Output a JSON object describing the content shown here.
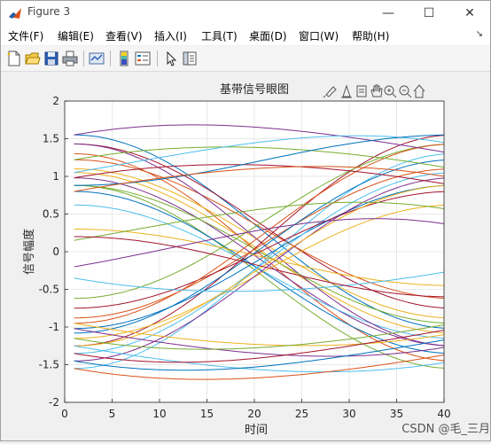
{
  "window": {
    "title": "Figure 3",
    "minimize": "—",
    "maximize": "☐",
    "close": "✕"
  },
  "menu": [
    {
      "label": "文件(F)"
    },
    {
      "label": "编辑(E)"
    },
    {
      "label": "查看(V)"
    },
    {
      "label": "插入(I)"
    },
    {
      "label": "工具(T)"
    },
    {
      "label": "桌面(D)"
    },
    {
      "label": "窗口(W)"
    },
    {
      "label": "帮助(H)"
    }
  ],
  "toolbar": [
    {
      "icon": "new-figure-icon"
    },
    {
      "icon": "open-file-icon"
    },
    {
      "icon": "save-icon"
    },
    {
      "icon": "print-icon"
    },
    {
      "icon": "link-figure-icon"
    },
    {
      "icon": "insert-colorbar-icon"
    },
    {
      "icon": "insert-legend-icon"
    },
    {
      "icon": "edit-plot-icon"
    },
    {
      "icon": "property-inspector-icon"
    }
  ],
  "axes_toolbar": [
    {
      "icon": "brush-icon"
    },
    {
      "icon": "data-tips-icon"
    },
    {
      "icon": "export-icon"
    },
    {
      "icon": "pan-icon"
    },
    {
      "icon": "zoom-in-icon"
    },
    {
      "icon": "zoom-out-icon"
    },
    {
      "icon": "home-icon"
    }
  ],
  "watermark": "CSDN @毛_三月",
  "colors": [
    "#0072BD",
    "#D95319",
    "#EDB120",
    "#7E2F8E",
    "#77AC30",
    "#4DBEEE",
    "#A2142F"
  ],
  "chart_data": {
    "type": "line",
    "title": "基带信号眼图",
    "xlabel": "时间",
    "ylabel": "信号幅度",
    "xlim": [
      0,
      40
    ],
    "ylim": [
      -2,
      2
    ],
    "xticks": [
      "0",
      "5",
      "10",
      "15",
      "20",
      "25",
      "30",
      "35",
      "40"
    ],
    "yticks": [
      "-2",
      "-1.5",
      "-1",
      "-0.5",
      "0",
      "0.5",
      "1",
      "1.5",
      "2"
    ],
    "grid": true,
    "segment_x_range": [
      1,
      41
    ],
    "levels": [
      1.55,
      1.43,
      1.3,
      1.22,
      1.1,
      1.05,
      0.98,
      0.88,
      0.8,
      0.62,
      -0.62,
      -0.75,
      -0.88,
      -0.95,
      -1.02,
      -1.08,
      -1.15,
      -1.25,
      -1.35,
      -1.45,
      -1.55
    ],
    "traces": [
      {
        "start": 1.55,
        "end": -1.02
      },
      {
        "start": 1.3,
        "end": -1.45
      },
      {
        "start": 1.1,
        "end": -0.88
      },
      {
        "start": 0.98,
        "end": -1.25
      },
      {
        "start": 0.88,
        "end": -1.55
      },
      {
        "start": 0.62,
        "end": -1.15
      },
      {
        "start": 1.43,
        "end": -0.75
      },
      {
        "start": 0.8,
        "end": -1.35
      },
      {
        "start": 1.22,
        "end": -0.62
      },
      {
        "start": 1.05,
        "end": -1.08
      },
      {
        "start": 1.43,
        "end": -1.25
      },
      {
        "start": 0.88,
        "end": -0.95
      },
      {
        "start": -1.55,
        "end": 1.3
      },
      {
        "start": -1.25,
        "end": 1.55
      },
      {
        "start": -1.02,
        "end": 0.88
      },
      {
        "start": -0.88,
        "end": 1.1
      },
      {
        "start": -1.15,
        "end": 0.62
      },
      {
        "start": -1.45,
        "end": 0.98
      },
      {
        "start": -0.62,
        "end": 1.43
      },
      {
        "start": -1.35,
        "end": 1.05
      },
      {
        "start": -0.75,
        "end": 0.8
      },
      {
        "start": -1.08,
        "end": 1.22
      },
      {
        "start": -0.95,
        "end": 1.43
      },
      {
        "start": -1.25,
        "end": 0.88
      },
      {
        "start": 1.55,
        "end": 1.3
      },
      {
        "start": 1.22,
        "end": 1.1
      },
      {
        "start": 1.05,
        "end": 1.43
      },
      {
        "start": 0.98,
        "end": 0.88
      },
      {
        "start": 0.88,
        "end": 1.55
      },
      {
        "start": 0.8,
        "end": 0.98
      },
      {
        "start": -0.95,
        "end": -1.08
      },
      {
        "start": -1.02,
        "end": -1.25
      },
      {
        "start": -1.15,
        "end": -0.95
      },
      {
        "start": -1.25,
        "end": -1.45
      },
      {
        "start": -1.35,
        "end": -1.02
      },
      {
        "start": -1.45,
        "end": -1.15
      },
      {
        "start": -1.55,
        "end": -1.35
      },
      {
        "start": 0.3,
        "end": -0.45
      },
      {
        "start": -0.2,
        "end": 0.35
      },
      {
        "start": 0.15,
        "end": 0.55
      },
      {
        "start": -0.35,
        "end": -0.25
      },
      {
        "start": 0.2,
        "end": -0.6
      }
    ]
  }
}
